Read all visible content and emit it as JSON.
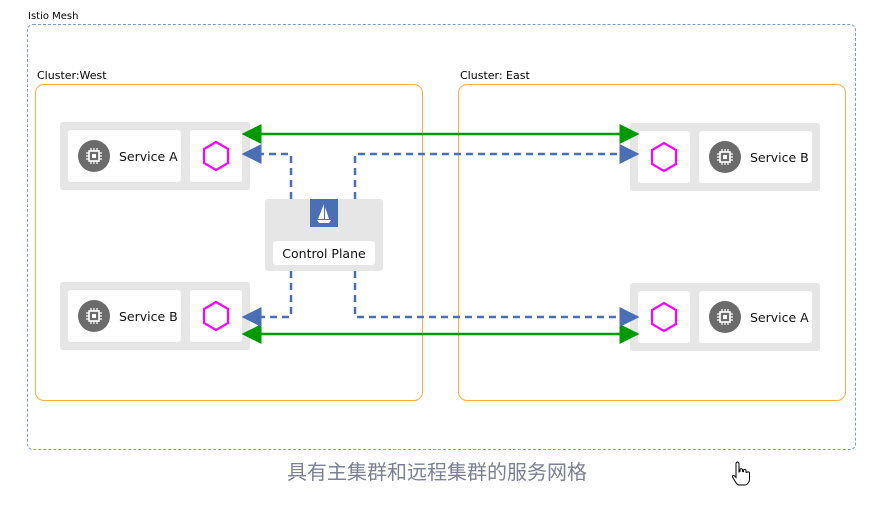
{
  "mesh": {
    "label": "Istio Mesh"
  },
  "west": {
    "label": "Cluster:West",
    "services": [
      {
        "name": "Service A"
      },
      {
        "name": "Service B"
      }
    ]
  },
  "east": {
    "label": "Cluster: East",
    "services": [
      {
        "name": "Service B"
      },
      {
        "name": "Service A"
      }
    ]
  },
  "control_plane": {
    "label": "Control Plane",
    "icon": "istio-sail-icon"
  },
  "caption": "具有主集群和远程集群的服务网格",
  "colors": {
    "cluster_border": "#f5b041",
    "mesh_border": "#7f9ccc",
    "mtls_arrow": "#009900",
    "control_arrow": "#4a6fb5",
    "sidecar": "#ff00ff"
  }
}
